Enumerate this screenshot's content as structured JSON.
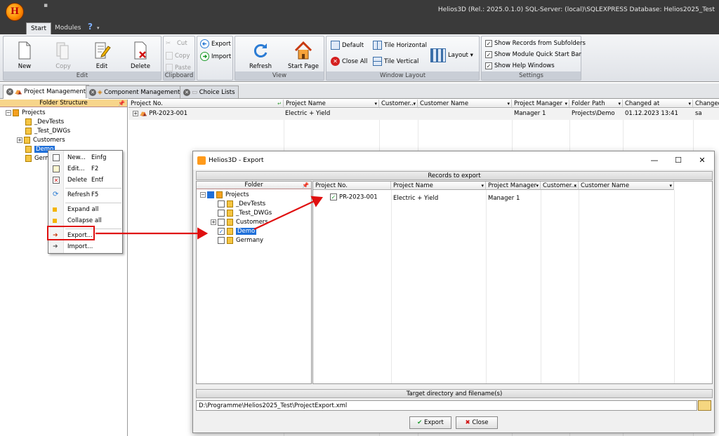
{
  "app": {
    "logo_letter": "H",
    "title_info": "Helios3D (Rel.: 2025.0.1.0)   SQL-Server: (local)\\SQLEXPRESS   Database: Helios2025_Test"
  },
  "ribbon_tabs": [
    "Start",
    "Modules"
  ],
  "ribbon": {
    "edit_group": {
      "caption": "Edit",
      "new": "New",
      "copy": "Copy",
      "edit": "Edit",
      "delete": "Delete"
    },
    "clipboard_group": {
      "caption": "Clipboard",
      "cut": "Cut",
      "copy": "Copy",
      "paste": "Paste"
    },
    "io_group": {
      "export": "Export",
      "import": "Import"
    },
    "view_group": {
      "caption": "View",
      "refresh": "Refresh",
      "start_page": "Start Page"
    },
    "window_group": {
      "caption": "Window Layout",
      "default": "Default",
      "tile_horizontal": "Tile Horizontal",
      "close_all": "Close All",
      "tile_vertical": "Tile Vertical",
      "layout": "Layout"
    },
    "settings_group": {
      "caption": "Settings",
      "show_records": "Show Records from Subfolders",
      "show_module": "Show Module Quick Start Bar",
      "show_help": "Show Help Windows"
    }
  },
  "doc_tabs": [
    "Project Management",
    "Component Management",
    "Choice Lists"
  ],
  "folder_pane": {
    "header": "Folder Structure",
    "root": "Projects",
    "items": [
      "_DevTests",
      "_Test_DWGs",
      "Customers",
      "Demo",
      "Germ"
    ]
  },
  "grid": {
    "headers": [
      "Project No.",
      "Project Name",
      "Customer...",
      "Customer Name",
      "Project Manager",
      "Folder Path",
      "Changed at",
      "Changed"
    ],
    "row": [
      "PR-2023-001",
      "Electric + Yield",
      "",
      "",
      "Manager 1",
      "Projects\\Demo",
      "01.12.2023 13:41",
      "sa"
    ]
  },
  "context_menu": {
    "new": {
      "label": "New...",
      "key": "Einfg"
    },
    "edit": {
      "label": "Edit...",
      "key": "F2"
    },
    "delete": {
      "label": "Delete",
      "key": "Entf"
    },
    "refresh": {
      "label": "Refresh",
      "key": "F5"
    },
    "expand_all": "Expand all",
    "collapse_all": "Collapse all",
    "export": "Export...",
    "import": "Import..."
  },
  "dialog": {
    "title": "Helios3D - Export",
    "records_header": "Records to export",
    "folder_header": "Folder",
    "tree_root": "Projects",
    "tree_items": [
      "_DevTests",
      "_Test_DWGs",
      "Customers",
      "Demo",
      "Germany"
    ],
    "grid_headers": [
      "Project No.",
      "Project Name",
      "Project Manager",
      "Customer...",
      "Customer Name"
    ],
    "grid_row": [
      "PR-2023-001",
      "Electric + Yield",
      "Manager 1",
      "",
      ""
    ],
    "target_header": "Target directory and filename(s)",
    "path": "D:\\Programme\\Helios2025_Test\\ProjectExport.xml",
    "export_btn": "Export",
    "close_btn": "Close"
  },
  "colors": {
    "annotation": "#e01010",
    "selection": "#1e6fd9"
  }
}
